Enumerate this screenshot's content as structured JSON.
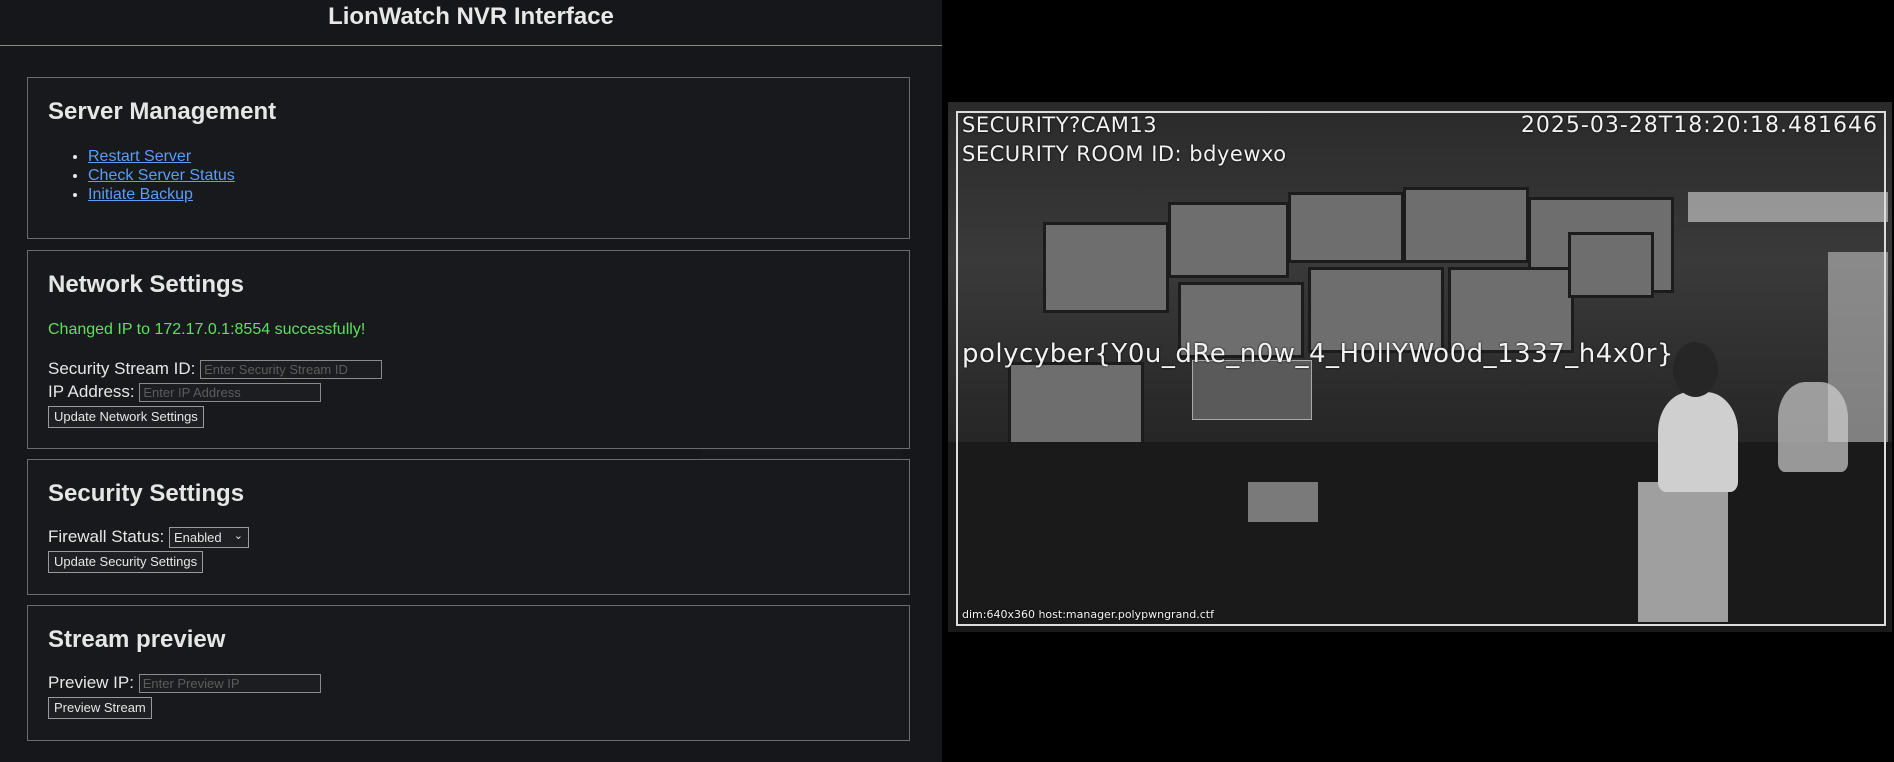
{
  "header": {
    "title": "LionWatch NVR Interface"
  },
  "server_management": {
    "title": "Server Management",
    "links": [
      "Restart Server",
      "Check Server Status",
      "Initiate Backup"
    ]
  },
  "network_settings": {
    "title": "Network Settings",
    "status_message": "Changed IP to 172.17.0.1:8554 successfully!",
    "stream_id_label": "Security Stream ID:",
    "stream_id_value": "",
    "stream_id_placeholder": "Enter Security Stream ID",
    "ip_label": "IP Address:",
    "ip_value": "",
    "ip_placeholder": "Enter IP Address",
    "button": "Update Network Settings"
  },
  "security_settings": {
    "title": "Security Settings",
    "firewall_label": "Firewall Status:",
    "firewall_selected": "Enabled",
    "button": "Update Security Settings"
  },
  "stream_preview": {
    "title": "Stream preview",
    "ip_label": "Preview IP:",
    "ip_value": "",
    "ip_placeholder": "Enter Preview IP",
    "button": "Preview Stream"
  },
  "camera_feed": {
    "camera_name": "SECURITY?CAM13",
    "room_id": "SECURITY ROOM ID: bdyewxo",
    "timestamp": "2025-03-28T18:20:18.481646",
    "flag_text": "polycyber{Y0u_dRe_n0w_4_H0llYWo0d_1337_h4x0r}",
    "footer": "dim:640x360 host:manager.polypwngrand.ctf"
  },
  "colors": {
    "panel_bg": "#17191c",
    "link": "#5a9ef5",
    "success": "#5ee05e",
    "page_bg": "#15171a"
  }
}
